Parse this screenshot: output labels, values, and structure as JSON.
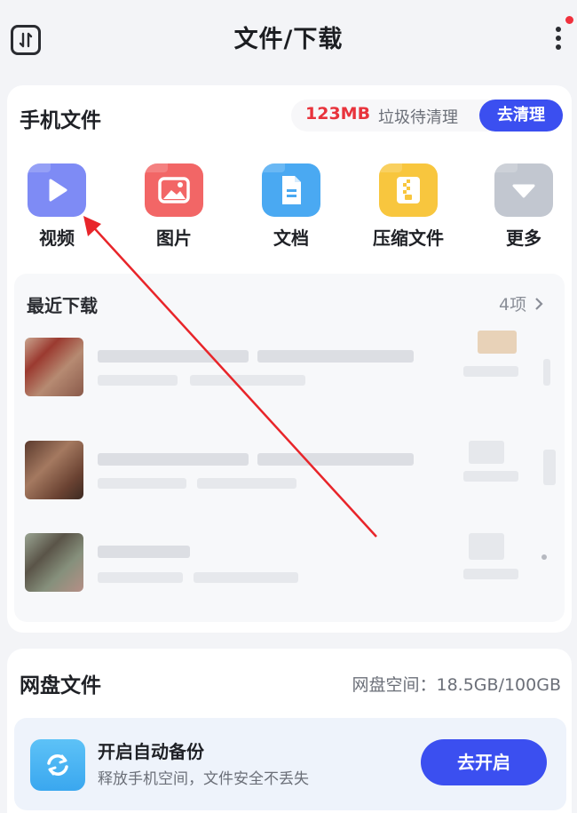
{
  "header": {
    "title": "文件/下载",
    "left_icon": "sort-icon",
    "more_icon": "more-vertical-icon",
    "notification_color": "#f0303c"
  },
  "phone_files": {
    "title": "手机文件",
    "junk_size": "123MB",
    "junk_label": "垃圾待清理",
    "clean_button": "去清理",
    "categories": [
      {
        "label": "视频",
        "icon": "video-icon",
        "color": "#7e8bf5"
      },
      {
        "label": "图片",
        "icon": "image-icon",
        "color": "#f26666"
      },
      {
        "label": "文档",
        "icon": "document-icon",
        "color": "#4aa9f2"
      },
      {
        "label": "压缩文件",
        "icon": "archive-icon",
        "color": "#f8c63e"
      },
      {
        "label": "更多",
        "icon": "more-chevron-icon",
        "color": "#c2c7d0"
      }
    ]
  },
  "recent_downloads": {
    "title": "最近下载",
    "count": "4项",
    "chevron_icon": "chevron-right-icon",
    "items": [
      {
        "thumb_color": "#9b5a4c"
      },
      {
        "thumb_color": "#7a4c3e"
      },
      {
        "thumb_color": "#6f7467"
      }
    ]
  },
  "cloud_files": {
    "title": "网盘文件",
    "space_label": "网盘空间：18.5GB/100GB",
    "backup_title": "开启自动备份",
    "backup_subtitle": "释放手机空间，文件安全不丢失",
    "backup_button": "去开启",
    "backup_icon": "sync-icon"
  },
  "colors": {
    "accent": "#3b4ff0",
    "junk_red": "#e8333c",
    "annotation_arrow": "#e8252a"
  }
}
